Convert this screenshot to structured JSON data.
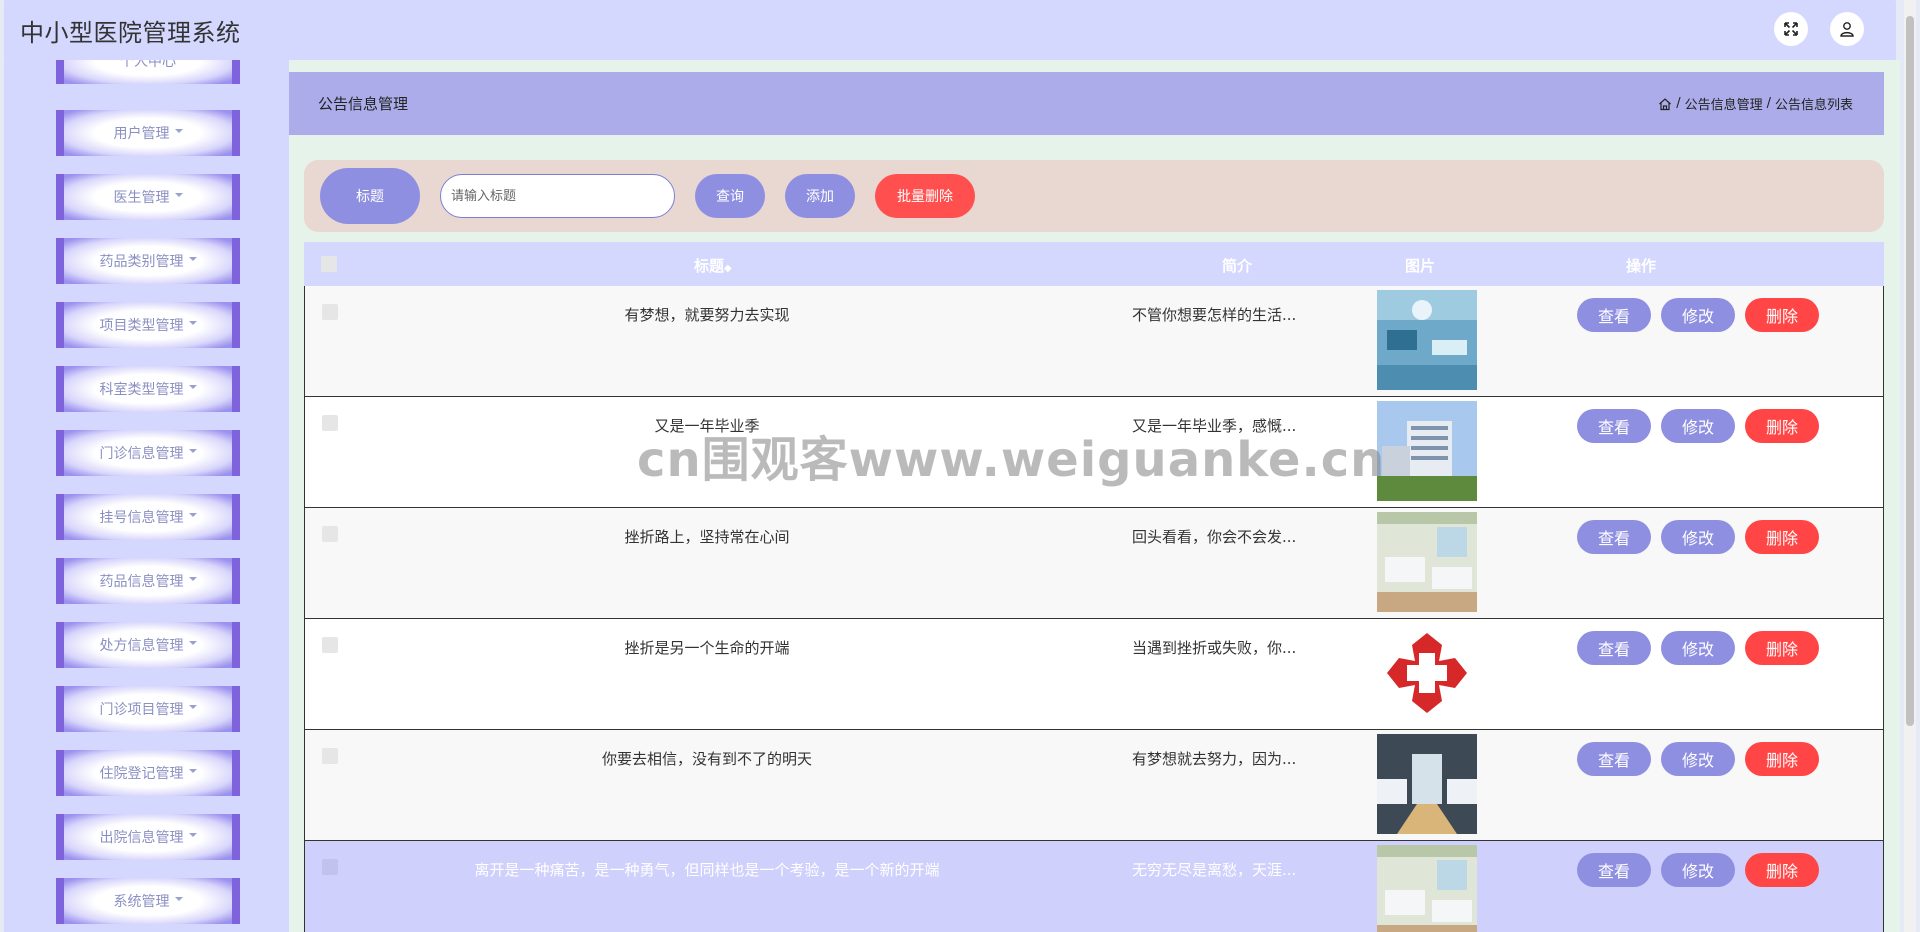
{
  "app": {
    "title": "中小型医院管理系统"
  },
  "top_actions": [
    {
      "icon": "fullscreen-icon"
    },
    {
      "icon": "user-icon"
    }
  ],
  "sidebar": {
    "partial_item": "个人中心",
    "items": [
      {
        "label": "用户管理"
      },
      {
        "label": "医生管理"
      },
      {
        "label": "药品类别管理"
      },
      {
        "label": "项目类型管理"
      },
      {
        "label": "科室类型管理"
      },
      {
        "label": "门诊信息管理"
      },
      {
        "label": "挂号信息管理"
      },
      {
        "label": "药品信息管理"
      },
      {
        "label": "处方信息管理"
      },
      {
        "label": "门诊项目管理"
      },
      {
        "label": "住院登记管理"
      },
      {
        "label": "出院信息管理"
      },
      {
        "label": "系统管理"
      }
    ]
  },
  "page": {
    "title": "公告信息管理",
    "breadcrumb": [
      "公告信息管理",
      "公告信息列表"
    ],
    "breadcrumb_sep": "/"
  },
  "search": {
    "label": "标题",
    "placeholder": "请输入标题",
    "query_label": "查询",
    "add_label": "添加",
    "batch_delete_label": "批量删除"
  },
  "table": {
    "columns": [
      "标题",
      "简介",
      "图片",
      "操作"
    ],
    "ops": {
      "view": "查看",
      "edit": "修改",
      "delete": "删除"
    },
    "rows": [
      {
        "title": "有梦想，就要努力去实现",
        "intro": "不管你想要怎样的生活...",
        "image": "operating-room-photo"
      },
      {
        "title": "又是一年毕业季",
        "intro": "又是一年毕业季，感慨...",
        "image": "hospital-building-photo"
      },
      {
        "title": "挫折路上，坚持常在心间",
        "intro": "回头看看，你会不会发...",
        "image": "ward-beds-photo"
      },
      {
        "title": "挫折是另一个生命的开端",
        "intro": "当遇到挫折或失败，你...",
        "image": "red-cross-logo"
      },
      {
        "title": "你要去相信，没有到不了的明天",
        "intro": "有梦想就去努力，因为...",
        "image": "ward-corridor-photo"
      },
      {
        "title": "离开是一种痛苦，是一种勇气，但同样也是一个考验，是一个新的开端",
        "intro": "无穷无尽是离愁，天涯...",
        "image": "ward-beds-photo"
      }
    ]
  },
  "watermark": "cn围观客www.weiguanke.cn",
  "colors": {
    "topbar": "#d4d7fe",
    "header": "#acacea",
    "accent": "#8f8fe2",
    "danger": "#ff4545",
    "main_bg": "#e5f3ea"
  }
}
